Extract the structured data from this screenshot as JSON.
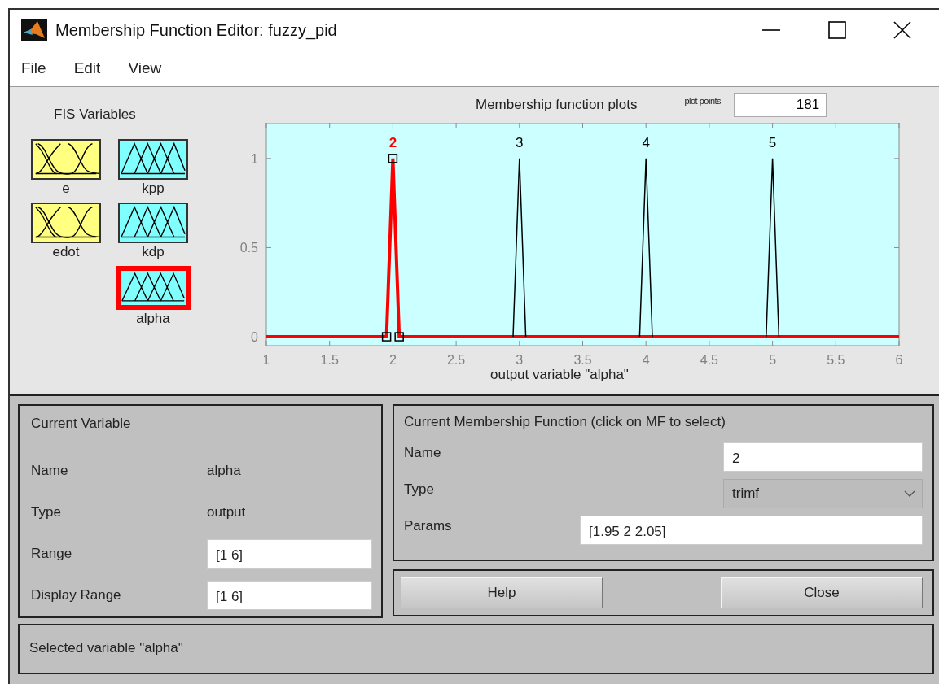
{
  "window": {
    "title": "Membership Function Editor: fuzzy_pid"
  },
  "menu": [
    "File",
    "Edit",
    "View"
  ],
  "fis_variables": {
    "title": "FIS Variables",
    "items": [
      {
        "name": "e",
        "kind": "input",
        "selected": false
      },
      {
        "name": "kpp",
        "kind": "output",
        "selected": false
      },
      {
        "name": "edot",
        "kind": "input",
        "selected": false
      },
      {
        "name": "kdp",
        "kind": "output",
        "selected": false
      },
      {
        "name": "alpha",
        "kind": "output",
        "selected": true
      }
    ]
  },
  "plot": {
    "title": "Membership function plots",
    "mf_labels": [
      {
        "selected": true
      },
      {
        "selected": false
      },
      {
        "selected": false
      },
      {
        "selected": false
      }
    ],
    "plot_points_label": "plot points",
    "plot_points": "181",
    "chart_data": {
      "type": "line",
      "xlabel": "output variable \"alpha\"",
      "x": [
        1,
        1.95,
        2,
        2.05,
        2.95,
        3,
        3.05,
        3.95,
        4,
        4.05,
        4.95,
        5,
        5.05,
        6
      ],
      "series": [
        {
          "name": "2",
          "color": "#ff0000",
          "values": [
            0,
            0,
            1,
            0,
            0,
            0,
            0,
            0,
            0,
            0,
            0,
            0,
            0,
            0
          ]
        },
        {
          "name": "3",
          "color": "#000000",
          "values": [
            null,
            null,
            null,
            null,
            0,
            1,
            0,
            null,
            null,
            null,
            null,
            null,
            null,
            null
          ]
        },
        {
          "name": "4",
          "color": "#000000",
          "values": [
            null,
            null,
            null,
            null,
            null,
            null,
            null,
            0,
            1,
            0,
            null,
            null,
            null,
            null
          ]
        },
        {
          "name": "5",
          "color": "#000000",
          "values": [
            null,
            null,
            null,
            null,
            null,
            null,
            null,
            null,
            null,
            null,
            0,
            1,
            0,
            null
          ]
        }
      ],
      "xlim": [
        1,
        6
      ],
      "ylim": [
        -0.05,
        1.2
      ],
      "xticks": [
        1,
        1.5,
        2,
        2.5,
        3,
        3.5,
        4,
        4.5,
        5,
        5.5,
        6
      ],
      "yticks": [
        0,
        0.5,
        1
      ]
    }
  },
  "current_variable": {
    "title": "Current Variable",
    "name_label": "Name",
    "name": "alpha",
    "type_label": "Type",
    "type": "output",
    "range_label": "Range",
    "range": "[1 6]",
    "display_range_label": "Display Range",
    "display_range": "[1 6]"
  },
  "current_mf": {
    "title": "Current Membership Function (click on MF to select)",
    "name_label": "Name",
    "name": "2",
    "type_label": "Type",
    "type": "trimf",
    "params_label": "Params",
    "params": "[1.95 2 2.05]"
  },
  "buttons": [
    "Help",
    "Close"
  ],
  "status": "Selected variable \"alpha\""
}
